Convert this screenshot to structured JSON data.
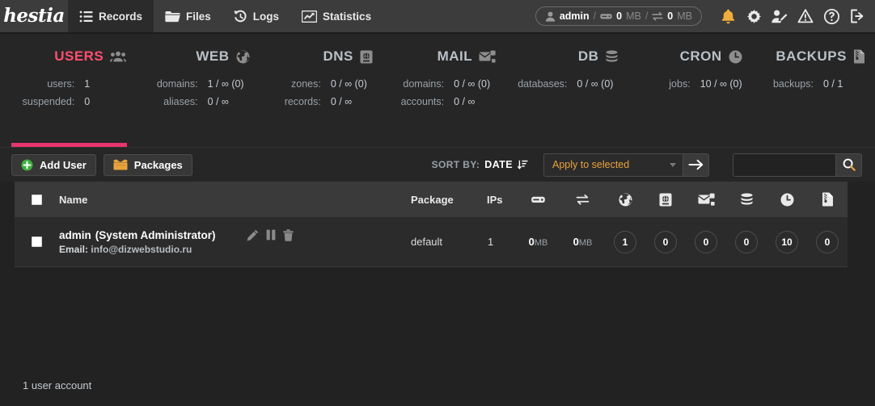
{
  "app": {
    "logo": "hestia"
  },
  "nav": {
    "items": [
      {
        "label": "Records",
        "icon": "list-icon",
        "active": true
      },
      {
        "label": "Files",
        "icon": "folder-icon",
        "active": false
      },
      {
        "label": "Logs",
        "icon": "history-icon",
        "active": false
      },
      {
        "label": "Statistics",
        "icon": "chart-icon",
        "active": false
      }
    ],
    "user_pill": {
      "icon": "user-icon",
      "username": "admin",
      "disk_icon": "disk-icon",
      "disk_value": "0",
      "disk_unit": "MB",
      "bandwidth_icon": "transfer-icon",
      "bandwidth_value": "0",
      "bandwidth_unit": "MB"
    },
    "tools": [
      {
        "name": "notifications-icon",
        "color": "#f0ad3c"
      },
      {
        "name": "gear-icon",
        "color": "#e9e9e9"
      },
      {
        "name": "edit-user-icon",
        "color": "#e9e9e9"
      },
      {
        "name": "warning-icon",
        "color": "#e9e9e9"
      },
      {
        "name": "help-icon",
        "color": "#e9e9e9"
      },
      {
        "name": "logout-icon",
        "color": "#e9e9e9"
      }
    ]
  },
  "stats": [
    {
      "title": "USERS",
      "icon": "users-icon",
      "active": true,
      "rows": [
        {
          "key": "users:",
          "value": "1"
        },
        {
          "key": "suspended:",
          "value": "0"
        }
      ]
    },
    {
      "title": "WEB",
      "icon": "globe-icon",
      "active": false,
      "rows": [
        {
          "key": "domains:",
          "value": "1 / ∞ (0)"
        },
        {
          "key": "aliases:",
          "value": "0 / ∞"
        }
      ]
    },
    {
      "title": "DNS",
      "icon": "dns-icon",
      "active": false,
      "rows": [
        {
          "key": "zones:",
          "value": "0 / ∞ (0)"
        },
        {
          "key": "records:",
          "value": "0 / ∞"
        }
      ]
    },
    {
      "title": "MAIL",
      "icon": "mail-icon",
      "active": false,
      "rows": [
        {
          "key": "domains:",
          "value": "0 / ∞ (0)"
        },
        {
          "key": "accounts:",
          "value": "0 / ∞"
        }
      ]
    },
    {
      "title": "DB",
      "icon": "database-icon",
      "active": false,
      "rows": [
        {
          "key": "databases:",
          "value": "0 / ∞ (0)"
        }
      ]
    },
    {
      "title": "CRON",
      "icon": "clock-icon",
      "active": false,
      "rows": [
        {
          "key": "jobs:",
          "value": "10 / ∞ (0)"
        }
      ]
    },
    {
      "title": "BACKUPS",
      "icon": "backup-icon",
      "active": false,
      "rows": [
        {
          "key": "backups:",
          "value": "0 / 1"
        }
      ]
    }
  ],
  "toolbar": {
    "add_user_label": "Add User",
    "packages_label": "Packages",
    "sort_label": "SORT BY:",
    "sort_value": "DATE",
    "apply_selected": "Apply to selected",
    "go_label": "→",
    "search_value": "",
    "search_placeholder": ""
  },
  "table": {
    "columns": {
      "name": "Name",
      "package": "Package",
      "ips": "IPs",
      "disk_icon": "disk-icon",
      "bandwidth_icon": "transfer-icon",
      "web_icon": "globe-icon",
      "dns_icon": "dns-icon",
      "mail_icon": "mail-icon",
      "db_icon": "database-icon",
      "cron_icon": "clock-icon",
      "backup_icon": "backup-icon"
    },
    "rows": [
      {
        "username": "admin",
        "fullname": "(System Administrator)",
        "email_label": "Email:",
        "email": "info@dizwebstudio.ru",
        "package": "default",
        "ips": "1",
        "disk": "0",
        "disk_unit": "MB",
        "bandwidth": "0",
        "bandwidth_unit": "MB",
        "web": "1",
        "dns": "0",
        "mail": "0",
        "db": "0",
        "cron": "10",
        "backups": "0",
        "actions": [
          "edit-icon",
          "suspend-icon",
          "delete-icon"
        ]
      }
    ]
  },
  "footer": {
    "count_text": "1 user account"
  },
  "colors": {
    "accent": "#e8356d",
    "header_bg": "#3c3c3c",
    "body_bg": "#222222",
    "stats_bg": "#262626",
    "row_bg": "#2b2b2b",
    "orange": "#e8a33d",
    "green": "#4caf50"
  }
}
